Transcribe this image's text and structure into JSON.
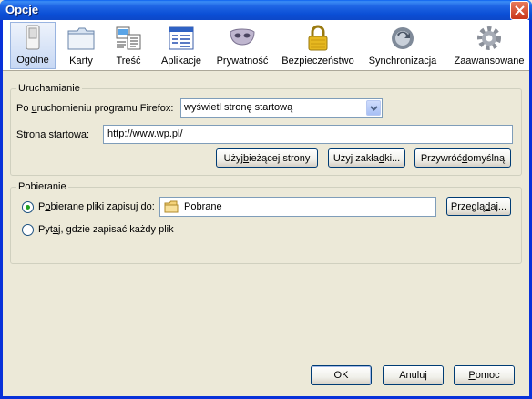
{
  "window": {
    "title": "Opcje"
  },
  "toolbar": {
    "items": [
      {
        "label": "Ogólne",
        "icon": "switch-icon"
      },
      {
        "label": "Karty",
        "icon": "tabs-icon"
      },
      {
        "label": "Treść",
        "icon": "content-icon"
      },
      {
        "label": "Aplikacje",
        "icon": "applications-icon"
      },
      {
        "label": "Prywatność",
        "icon": "privacy-mask-icon"
      },
      {
        "label": "Bezpieczeństwo",
        "icon": "padlock-icon"
      },
      {
        "label": "Synchronizacja",
        "icon": "sync-icon"
      },
      {
        "label": "Zaawansowane",
        "icon": "gear-icon"
      }
    ],
    "active_index": 0
  },
  "startup": {
    "group_title": "Uruchamianie",
    "on_start_label_pre": "Po ",
    "on_start_label_u": "u",
    "on_start_label_post": "ruchomieniu programu Firefox:",
    "on_start_value": "wyświetl stronę startową",
    "homepage_label": "Strona startowa:",
    "homepage_value": "http://www.wp.pl/",
    "use_current_pre": "Użyj ",
    "use_current_u": "b",
    "use_current_post": "ieżącej strony",
    "use_bookmark_pre": "Użyj zakła",
    "use_bookmark_u": "d",
    "use_bookmark_post": "ki...",
    "restore_pre": "Przywróć ",
    "restore_u": "d",
    "restore_post": "omyślną"
  },
  "downloads": {
    "group_title": "Pobieranie",
    "save_to_pre": "P",
    "save_to_u": "o",
    "save_to_post": "bierane pliki zapisuj do:",
    "folder_value": "Pobrane",
    "browse_pre": "Przeglą",
    "browse_u": "d",
    "browse_post": "aj...",
    "ask_pre": "Pyt",
    "ask_u": "a",
    "ask_post": "j, gdzie zapisać każdy plik"
  },
  "footer": {
    "ok": "OK",
    "cancel": "Anuluj",
    "help_u": "P",
    "help_post": "omoc"
  }
}
